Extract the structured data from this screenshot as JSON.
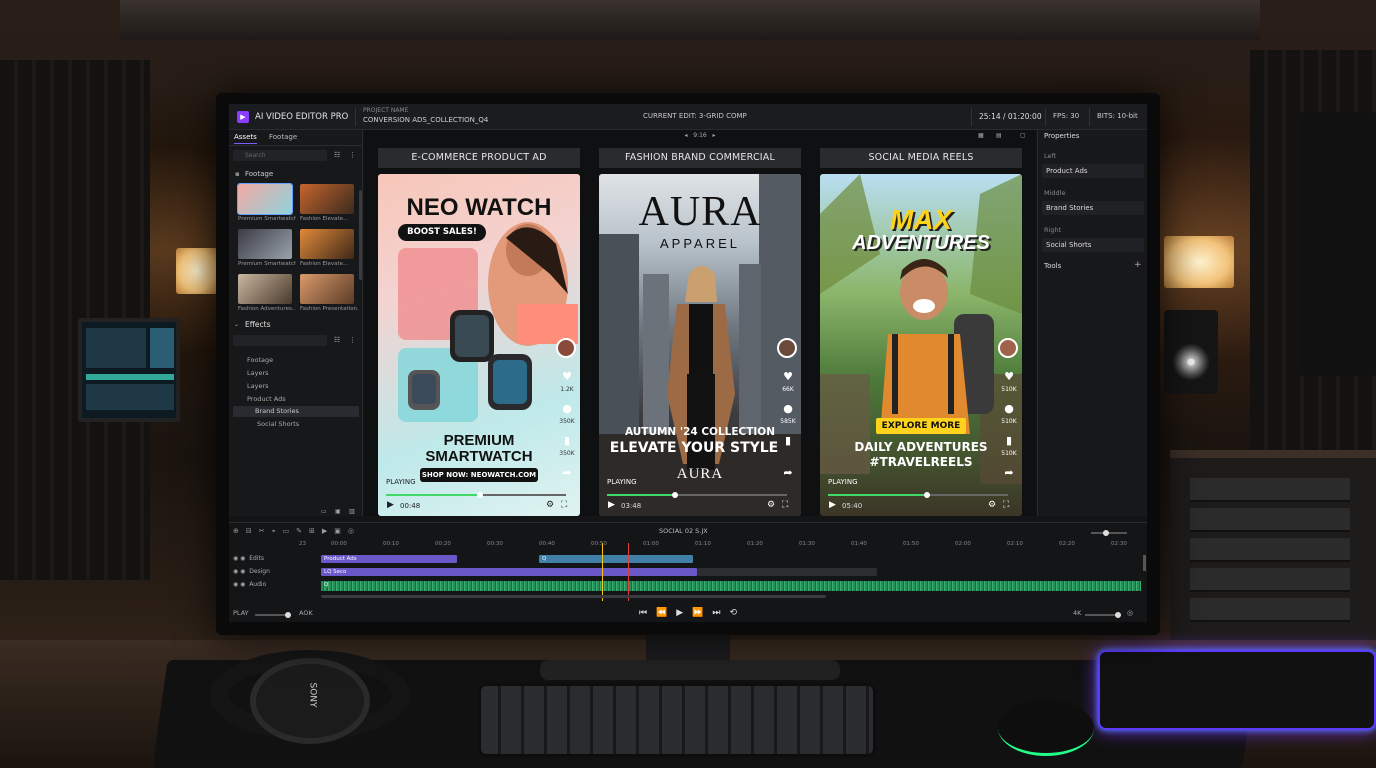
{
  "app": {
    "name": "AI VIDEO EDITOR PRO",
    "project_label": "PROJECT NAME",
    "project_name": "CONVERSION ADS_COLLECTION_Q4",
    "current_edit": "CURRENT EDIT: 3-GRID COMP",
    "timecode": "25:14 / 01:20:00",
    "fps": "FPS: 30",
    "bits": "BITS: 10-bit",
    "accent_color": "#7a5cff"
  },
  "left_panel": {
    "tabs": [
      "Assets",
      "Footage"
    ],
    "search_placeholder": "Search",
    "folder_label": "Footage",
    "thumbnails": [
      "Premium Smartwatch...",
      "Fashion Elevate...",
      "Premium Smartwatch...",
      "Fashion Elevate...",
      "Fashion Adventures...",
      "Fashion Presentation..."
    ],
    "effects_heading": "Effects",
    "tree": [
      "Footage",
      "Layers",
      "Layers",
      "Product Ads",
      "Brand Stories",
      "Social Shorts"
    ]
  },
  "center": {
    "nav_label": "9:16",
    "cards": [
      {
        "title": "E-COMMERCE PRODUCT AD",
        "headline": "NEO WATCH",
        "badge": "BOOST SALES!",
        "bottom_line1": "PREMIUM",
        "bottom_line2": "SMARTWATCH",
        "cta": "SHOP NOW: NEOWATCH.COM",
        "status": "PLAYING",
        "time": "00:48",
        "counts": [
          "1.2K",
          "350K",
          "350K"
        ],
        "progress": 0.52
      },
      {
        "title": "FASHION BRAND COMMERCIAL",
        "headline": "AURA",
        "subhead": "APPAREL",
        "collection": "AUTUMN '24 COLLECTION",
        "tagline": "ELEVATE YOUR STYLE",
        "logo_text": "AURA",
        "status": "PLAYING",
        "time": "03:48",
        "counts": [
          "66K",
          "585K"
        ],
        "progress": 0.38
      },
      {
        "title": "SOCIAL MEDIA REELS",
        "headline1": "MAX",
        "headline2": "ADVENTURES",
        "cta": "EXPLORE MORE",
        "line1": "DAILY ADVENTURES",
        "line2": "#TRAVELREELS",
        "status": "PLAYING",
        "time": "05:40",
        "counts": [
          "510K",
          "510K",
          "510K"
        ],
        "progress": 0.55
      }
    ]
  },
  "right_panel": {
    "heading": "Properties",
    "fields": [
      {
        "label": "Left",
        "value": "Product Ads"
      },
      {
        "label": "Middle",
        "value": "Brand Stories"
      },
      {
        "label": "Right",
        "value": "Social Shorts"
      }
    ],
    "tools_label": "Tools"
  },
  "timeline": {
    "center_label": "SOCIAL 02 S.JX",
    "ruler_start": "23",
    "ruler": [
      "00:00",
      "00:10",
      "00:20",
      "00:30",
      "00:40",
      "00:50",
      "01:00",
      "01:10",
      "01:20",
      "01:30",
      "01:40",
      "01:50",
      "02:00",
      "02:10",
      "02:20",
      "02:30"
    ],
    "tracks": [
      {
        "label": "Edits",
        "clips": [
          "Product Ads",
          "Q"
        ]
      },
      {
        "label": "Design",
        "clips": [
          "LQ Seco"
        ]
      },
      {
        "label": "Audio",
        "clips": [
          "Q"
        ]
      }
    ],
    "play_label": "PLAY",
    "volume_label": "AOK",
    "zoom_label": "4K"
  },
  "desk": {
    "headphone_brand": "SONY"
  }
}
